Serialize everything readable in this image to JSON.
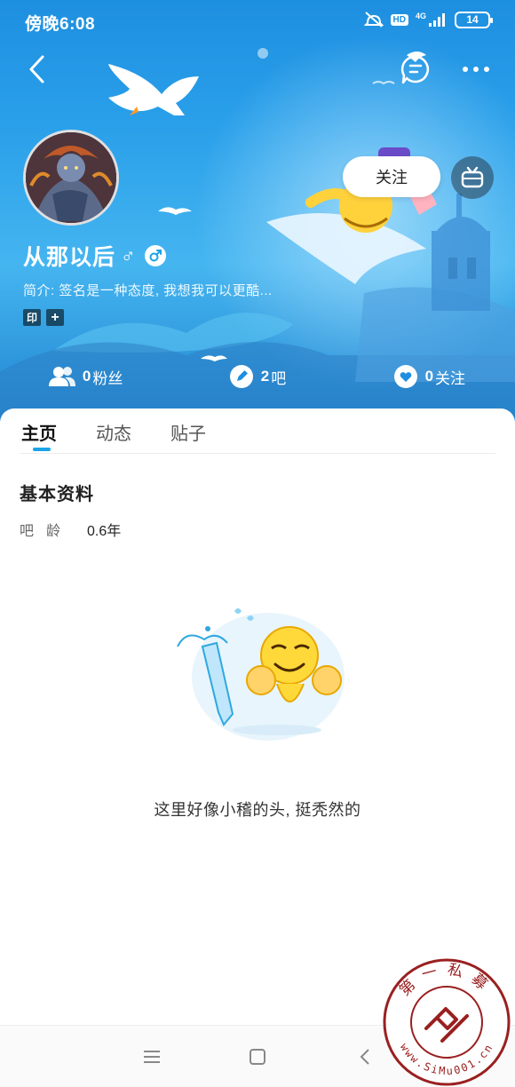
{
  "status_bar": {
    "time": "傍晚6:08",
    "hd_badge": "HD",
    "network": "4G",
    "battery": "14"
  },
  "nav": {
    "back_icon": "chevron-left-icon",
    "message_icon": "chat-bubble-icon",
    "more_icon": "more-dots-icon"
  },
  "profile": {
    "username": "从那以后",
    "gender_symbol": "♂",
    "bio": "简介: 签名是一种态度, 我想我可以更酷...",
    "tags": [
      "印",
      "+"
    ],
    "follow_label": "关注",
    "tv_icon": "tv-icon"
  },
  "stats": [
    {
      "icon": "users-icon",
      "value": "0",
      "label": "粉丝"
    },
    {
      "icon": "pencil-icon",
      "value": "2",
      "label": "吧"
    },
    {
      "icon": "heart-icon",
      "value": "0",
      "label": "关注"
    }
  ],
  "tabs": [
    {
      "label": "主页",
      "active": true
    },
    {
      "label": "动态",
      "active": false
    },
    {
      "label": "贴子",
      "active": false
    }
  ],
  "basic_info": {
    "title": "基本资料",
    "rows": [
      {
        "label": "吧龄",
        "value": "0.6年"
      }
    ]
  },
  "empty_state": {
    "text": "这里好像小稽的头, 挺秃然的"
  },
  "system_nav": {
    "menu_icon": "menu-icon",
    "home_icon": "square-home-icon",
    "back_icon": "triangle-back-icon"
  },
  "watermark": {
    "text_top": "第一私募",
    "text_bottom": "www.SiMu001.cn"
  },
  "colors": {
    "accent": "#1aa4e6",
    "hero_top": "#1e8fe0",
    "hero_bottom": "#1f83cf"
  }
}
